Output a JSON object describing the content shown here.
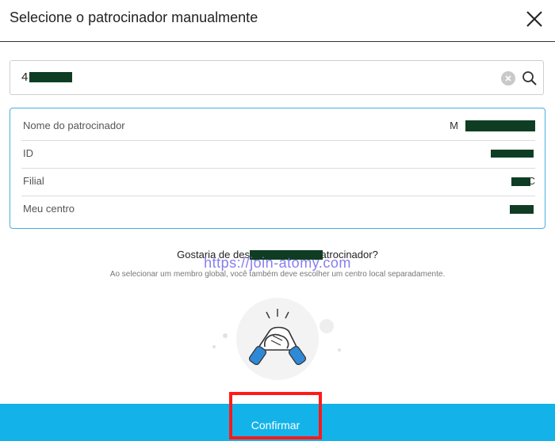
{
  "dialog": {
    "title": "Selecione o patrocinador manualmente"
  },
  "search": {
    "value": "4"
  },
  "sponsor": {
    "rows": [
      {
        "label": "Nome do patrocinador",
        "value": "M"
      },
      {
        "label": "ID",
        "value": ""
      },
      {
        "label": "Filial",
        "value": "C"
      },
      {
        "label": "Meu centro",
        "value": ""
      }
    ]
  },
  "prompt": {
    "question": "Gostaria de designar M                    como patrocinador?",
    "watermark": "https://join-atomy.com",
    "note": "Ao selecionar um membro global, você também deve escolher um centro local separadamente."
  },
  "footer": {
    "confirm_label": "Confirmar"
  },
  "colors": {
    "footer": "#13b3e9",
    "info_border": "#4aaee2",
    "highlight": "#ff1a1a",
    "mask": "#0f3d24"
  }
}
